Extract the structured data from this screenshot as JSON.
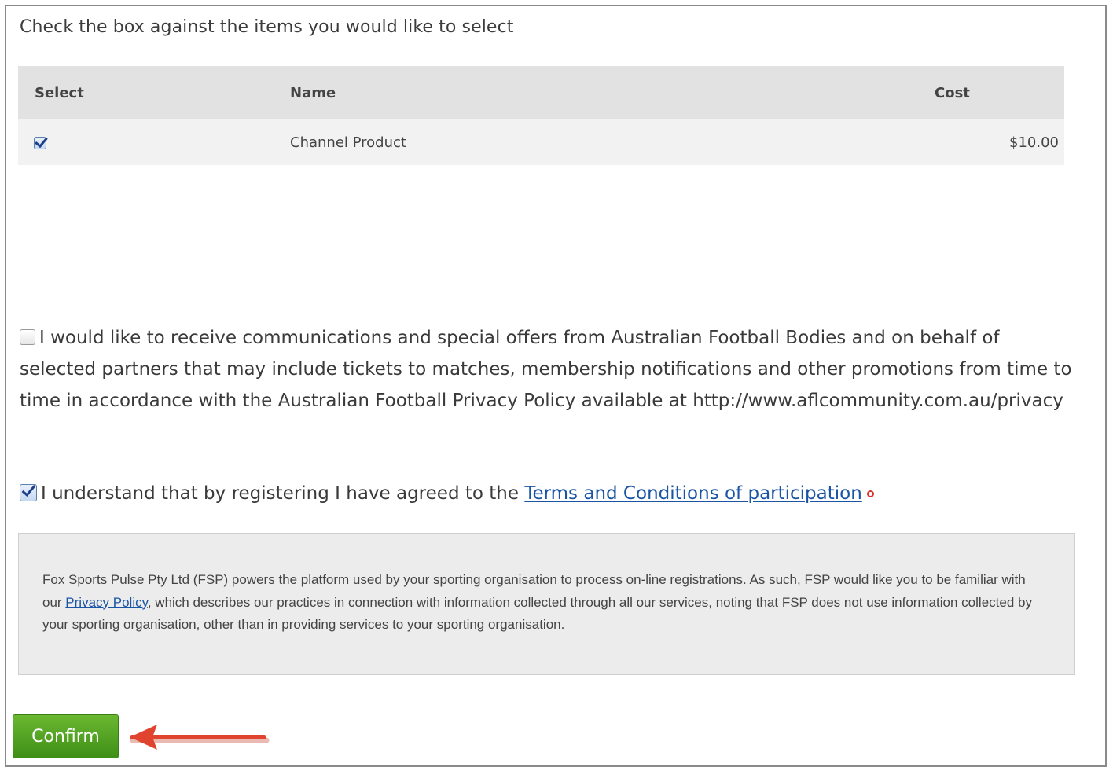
{
  "instructions": "Check the box against the items you would like to select",
  "table": {
    "headers": [
      "Select",
      "Name",
      "Cost"
    ],
    "rows": [
      {
        "selected": true,
        "name": "Channel Product",
        "cost": "$10.00"
      }
    ]
  },
  "consent": {
    "checked": false,
    "text": "I would like to receive communications and special offers from Australian Football Bodies and on behalf of selected partners that may include tickets to matches, membership notifications and other promotions from time to time in accordance with the Australian Football Privacy Policy available at http://www.aflcommunity.com.au/privacy"
  },
  "terms": {
    "checked": true,
    "prefix": "I understand that by registering I have agreed to the ",
    "link_text": "Terms and Conditions of participation"
  },
  "notice": {
    "before": "Fox Sports Pulse Pty Ltd (FSP) powers the platform used by your sporting organisation to process on-line registrations. As such, FSP would like you to be familiar with our ",
    "link_text": "Privacy Policy",
    "after": ", which describes our practices in connection with information collected through all our services, noting that FSP does not use information collected by your sporting organisation, other than in providing services to your sporting organisation."
  },
  "confirm_label": "Confirm",
  "colors": {
    "link": "#1a55a5",
    "confirm_button": "#4fa21f",
    "arrow": "#e0442f",
    "required": "#d9322c"
  }
}
